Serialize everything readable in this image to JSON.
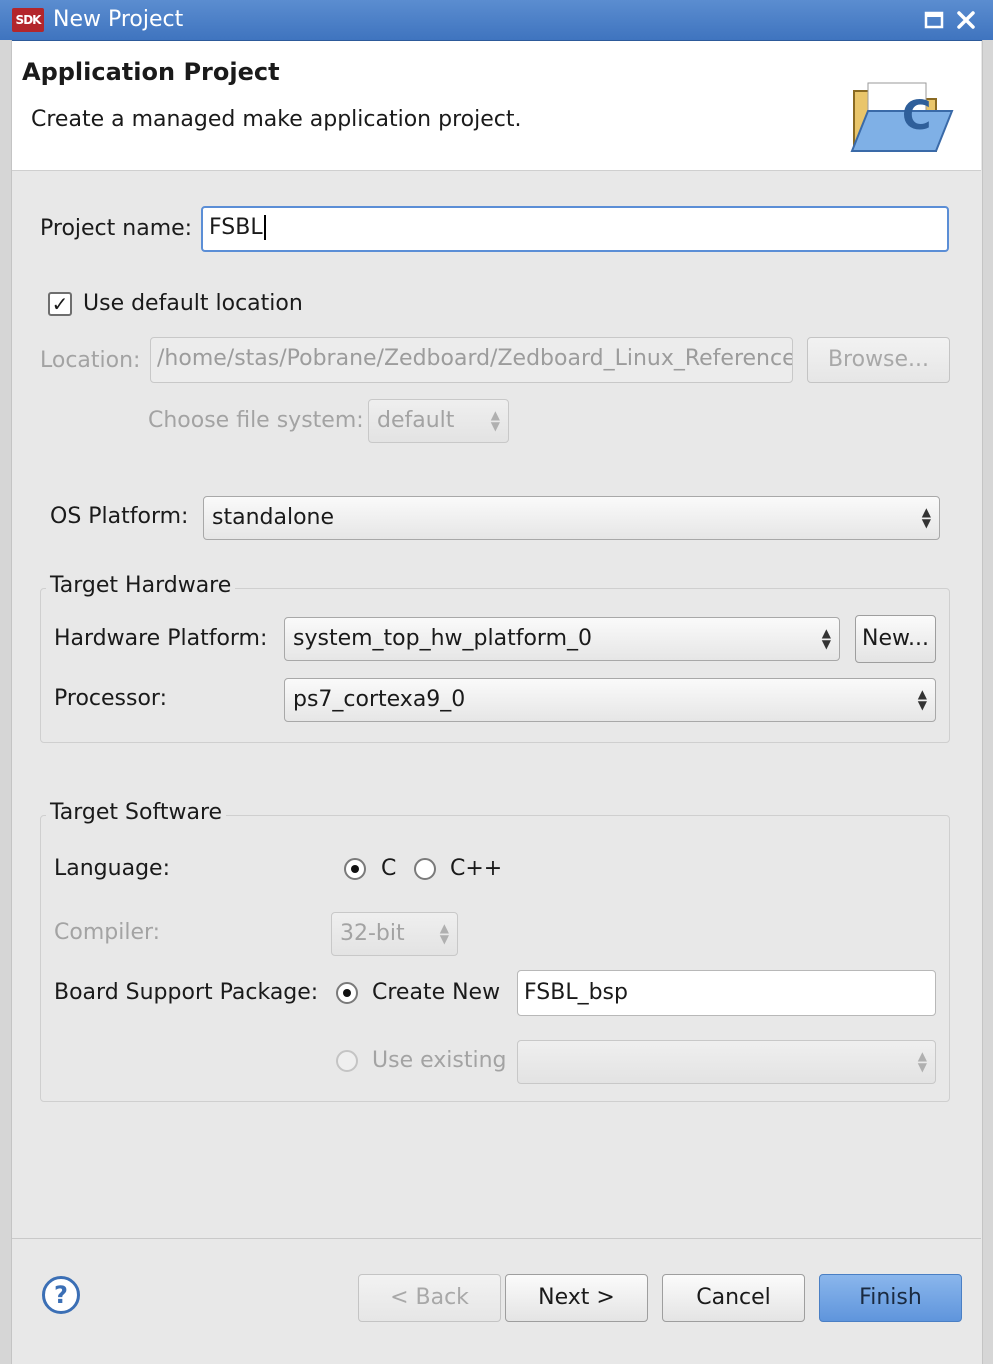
{
  "window": {
    "title": "New Project",
    "app_icon_text": "SDK"
  },
  "header": {
    "title": "Application Project",
    "subtitle": "Create a managed make application project."
  },
  "form": {
    "project_name_label": "Project name:",
    "project_name_value": "FSBL",
    "use_default_location_label": "Use default location",
    "use_default_location_checked": true,
    "location_label": "Location:",
    "location_value": "/home/stas/Pobrane/Zedboard/Zedboard_Linux_Reference_",
    "browse_label": "Browse...",
    "file_system_label": "Choose file system:",
    "file_system_value": "default",
    "os_platform_label": "OS Platform:",
    "os_platform_value": "standalone"
  },
  "target_hardware": {
    "title": "Target Hardware",
    "hw_platform_label": "Hardware Platform:",
    "hw_platform_value": "system_top_hw_platform_0",
    "new_label": "New...",
    "processor_label": "Processor:",
    "processor_value": "ps7_cortexa9_0"
  },
  "target_software": {
    "title": "Target Software",
    "language_label": "Language:",
    "lang_c": "C",
    "lang_cpp": "C++",
    "selected_language": "C",
    "compiler_label": "Compiler:",
    "compiler_value": "32-bit",
    "bsp_label": "Board Support Package:",
    "create_new_label": "Create New",
    "bsp_name_value": "FSBL_bsp",
    "use_existing_label": "Use existing"
  },
  "buttons": {
    "help": "?",
    "back": "< Back",
    "next": "Next >",
    "cancel": "Cancel",
    "finish": "Finish"
  }
}
